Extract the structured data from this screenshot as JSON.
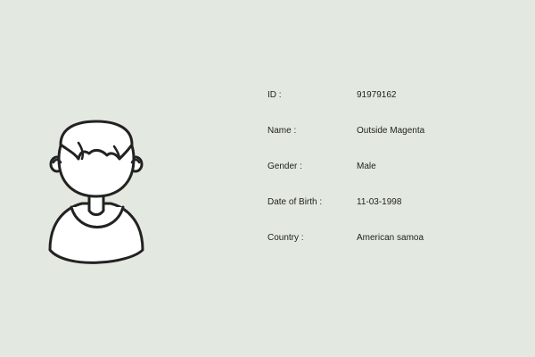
{
  "colors": {
    "background": "#e3e9e0",
    "text": "#1f1f1f",
    "avatar_fill": "#ffffff",
    "avatar_stroke": "#222222"
  },
  "avatar": {
    "icon": "person-avatar-icon"
  },
  "fields": [
    {
      "label": "ID :",
      "value": "91979162"
    },
    {
      "label": "Name :",
      "value": "Outside Magenta"
    },
    {
      "label": "Gender :",
      "value": "Male"
    },
    {
      "label": "Date of Birth :",
      "value": "11-03-1998"
    },
    {
      "label": "Country :",
      "value": "American samoa"
    }
  ]
}
